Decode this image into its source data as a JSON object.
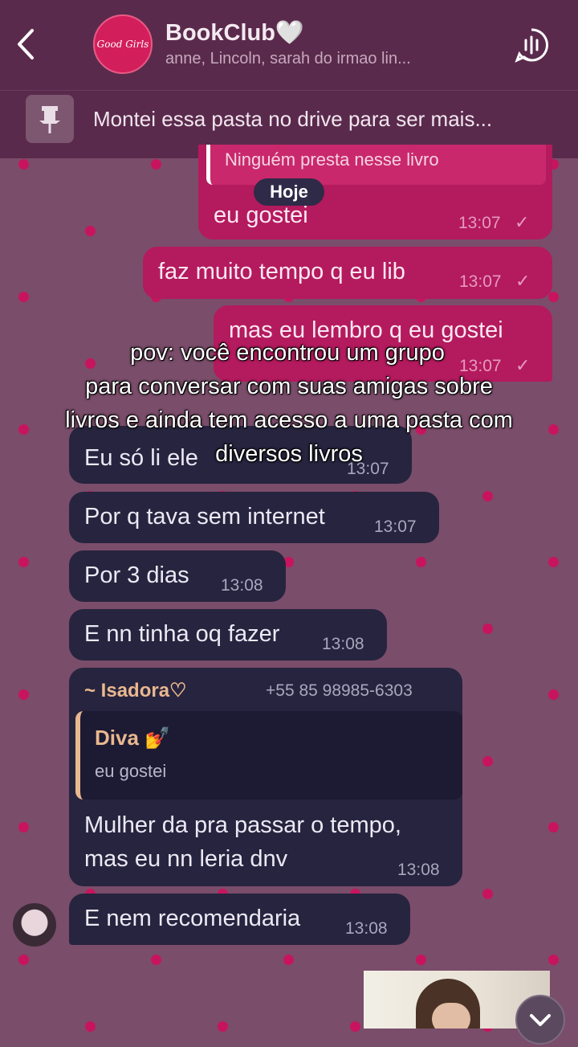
{
  "header": {
    "title": "BookClub🤍",
    "subtitle": "anne, Lincoln, sarah do irmao lin...",
    "avatar_text": "Good Girls"
  },
  "pinned": {
    "text": "Montei essa pasta no drive para ser mais..."
  },
  "date_chip": "Hoje",
  "outgoing": [
    {
      "quote": "Ninguém presta nesse livro",
      "text": "eu gostei",
      "time": "13:07",
      "status": "✓"
    },
    {
      "text": "faz muito tempo q eu lib",
      "time": "13:07",
      "status": "✓"
    },
    {
      "text": "mas eu lembro q eu gostei",
      "time": "13:07",
      "status": "✓"
    }
  ],
  "incoming": [
    {
      "text": "Eu só li ele",
      "time": "13:07"
    },
    {
      "text": "Por q tava sem internet",
      "time": "13:07"
    },
    {
      "text": "Por 3 dias",
      "time": "13:08"
    },
    {
      "text": "E nn tinha oq fazer",
      "time": "13:08"
    },
    {
      "sender": "~ Isadora♡",
      "phone": "+55 85 98985-6303",
      "reply_to": "Diva 💅",
      "reply_text": "eu gostei",
      "text_line1": "Mulher da pra passar o tempo,",
      "text_line2": "mas eu nn leria dnv",
      "time": "13:08"
    },
    {
      "text": "E nem recomendaria",
      "time": "13:08"
    }
  ],
  "caption": {
    "line1": "pov: você encontrou um grupo",
    "line2": "para conversar com suas amigas sobre",
    "line3": "livros e ainda tem acesso a uma pasta com",
    "line4": "diversos livros"
  },
  "colors": {
    "header": "#5a2a4c",
    "outgoing_bubble": "#b41a5e",
    "incoming_bubble": "#27243f",
    "wallpaper": "#7a4d6a",
    "wallpaper_dots": "#c8145e"
  }
}
